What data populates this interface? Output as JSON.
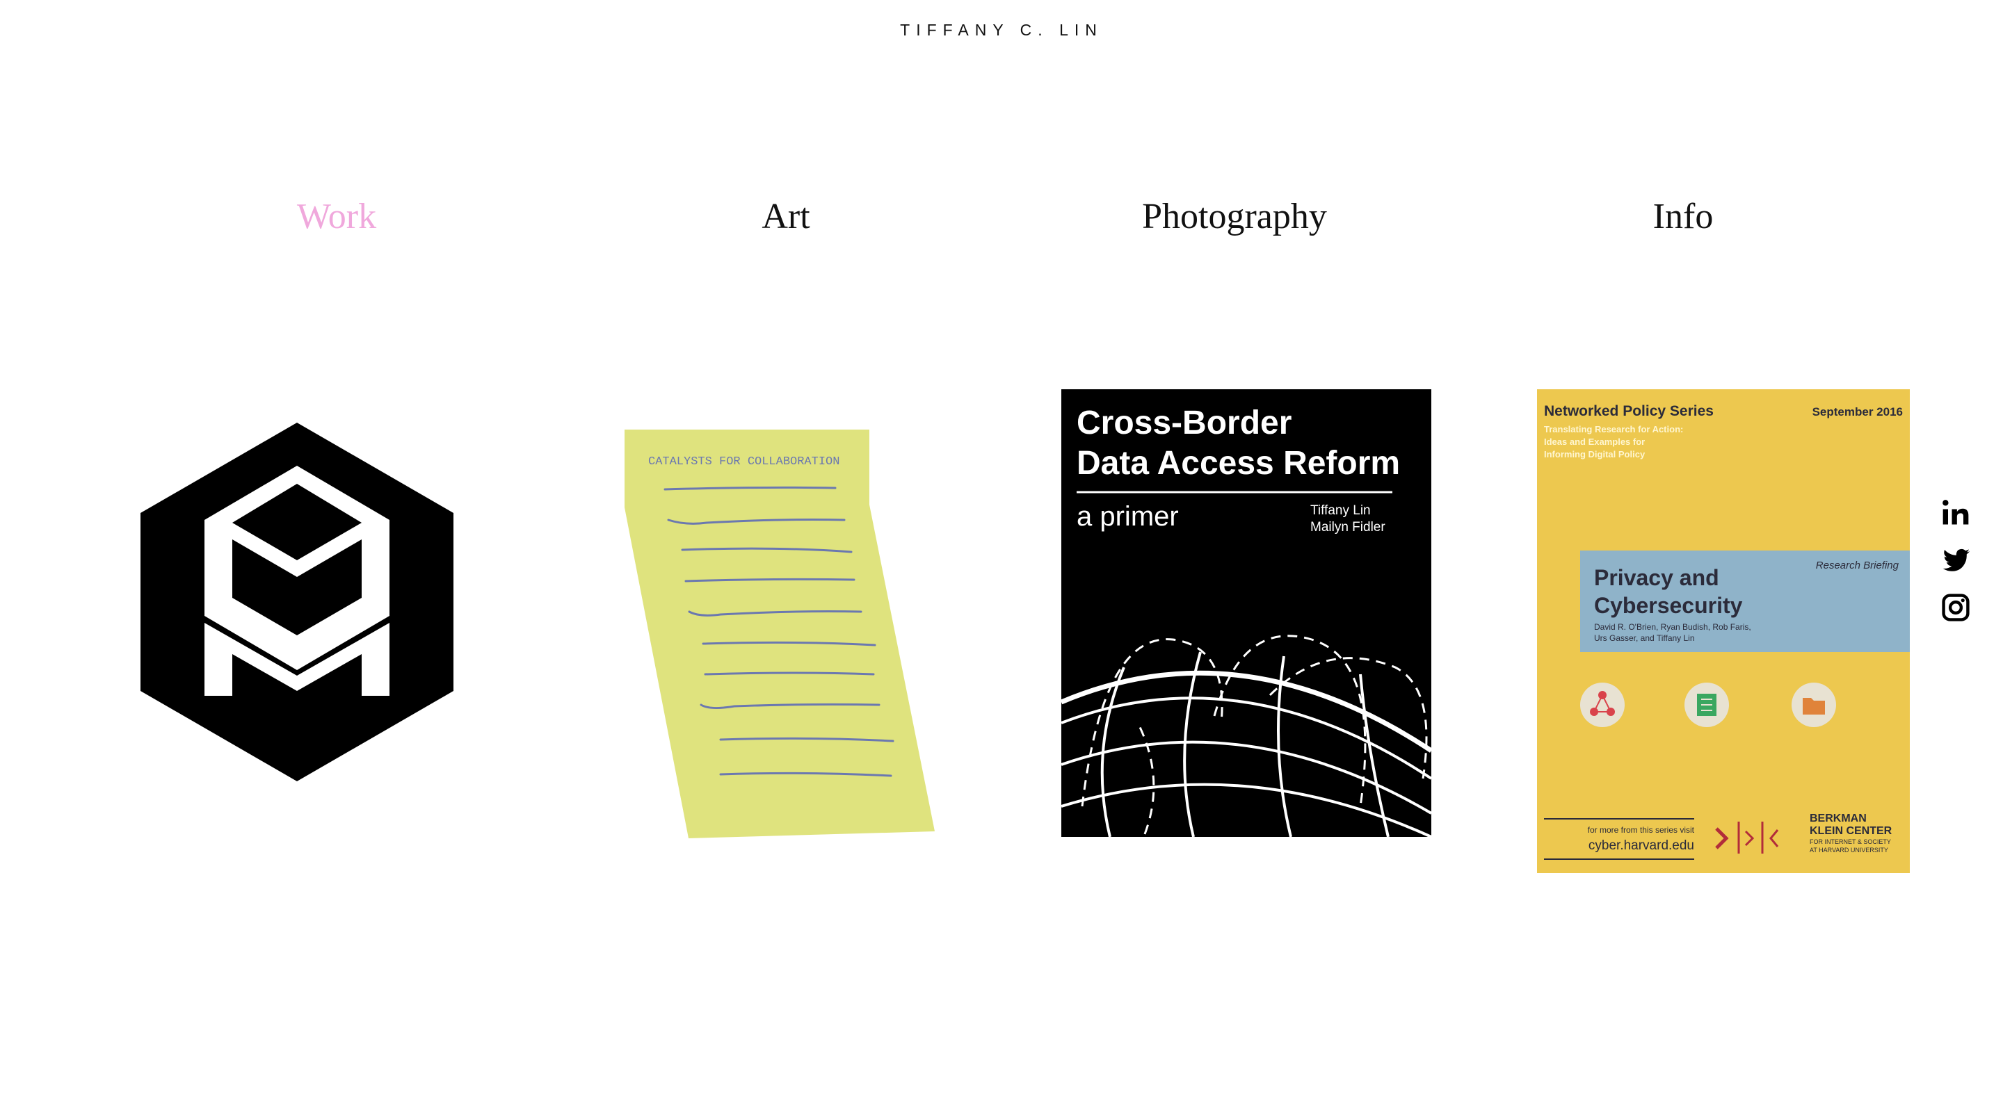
{
  "site": {
    "title": "TIFFANY C. LIN"
  },
  "nav": {
    "items": [
      {
        "label": "Work",
        "active": true
      },
      {
        "label": "Art",
        "active": false
      },
      {
        "label": "Photography",
        "active": false
      },
      {
        "label": "Info",
        "active": false
      }
    ],
    "active_color": "#f0a8dc"
  },
  "tiles": {
    "catalysts": {
      "heading": "CATALYSTS FOR COLLABORATION"
    },
    "cross_border": {
      "title_line1": "Cross-Border",
      "title_line2": "Data Access Reform",
      "subtitle": "a primer",
      "author1": "Tiffany Lin",
      "author2": "Mailyn Fidler"
    },
    "networked_policy": {
      "series": "Networked Policy Series",
      "date": "September 2016",
      "tagline1": "Translating Research for Action:",
      "tagline2": "Ideas and Examples for",
      "tagline3": "Informing Digital Policy",
      "title_line1": "Privacy and",
      "title_line2": "Cybersecurity",
      "tag": "Research Briefing",
      "authors1": "David R. O'Brien, Ryan Budish, Rob Faris,",
      "authors2": "Urs Gasser, and Tiffany Lin",
      "more": "for more from this series visit",
      "url": "cyber.harvard.edu",
      "org1": "BERKMAN",
      "org2": "KLEIN CENTER",
      "org3": "FOR INTERNET & SOCIETY",
      "org4": "AT HARVARD UNIVERSITY"
    }
  },
  "social": [
    "linkedin-icon",
    "twitter-icon",
    "instagram-icon"
  ],
  "colors": {
    "accent": "#f0a8dc",
    "note_yellow": "#dfe37e",
    "note_ink": "#6b78b0",
    "poster_yellow": "#edc84f",
    "poster_blue": "#8fb3c9"
  }
}
